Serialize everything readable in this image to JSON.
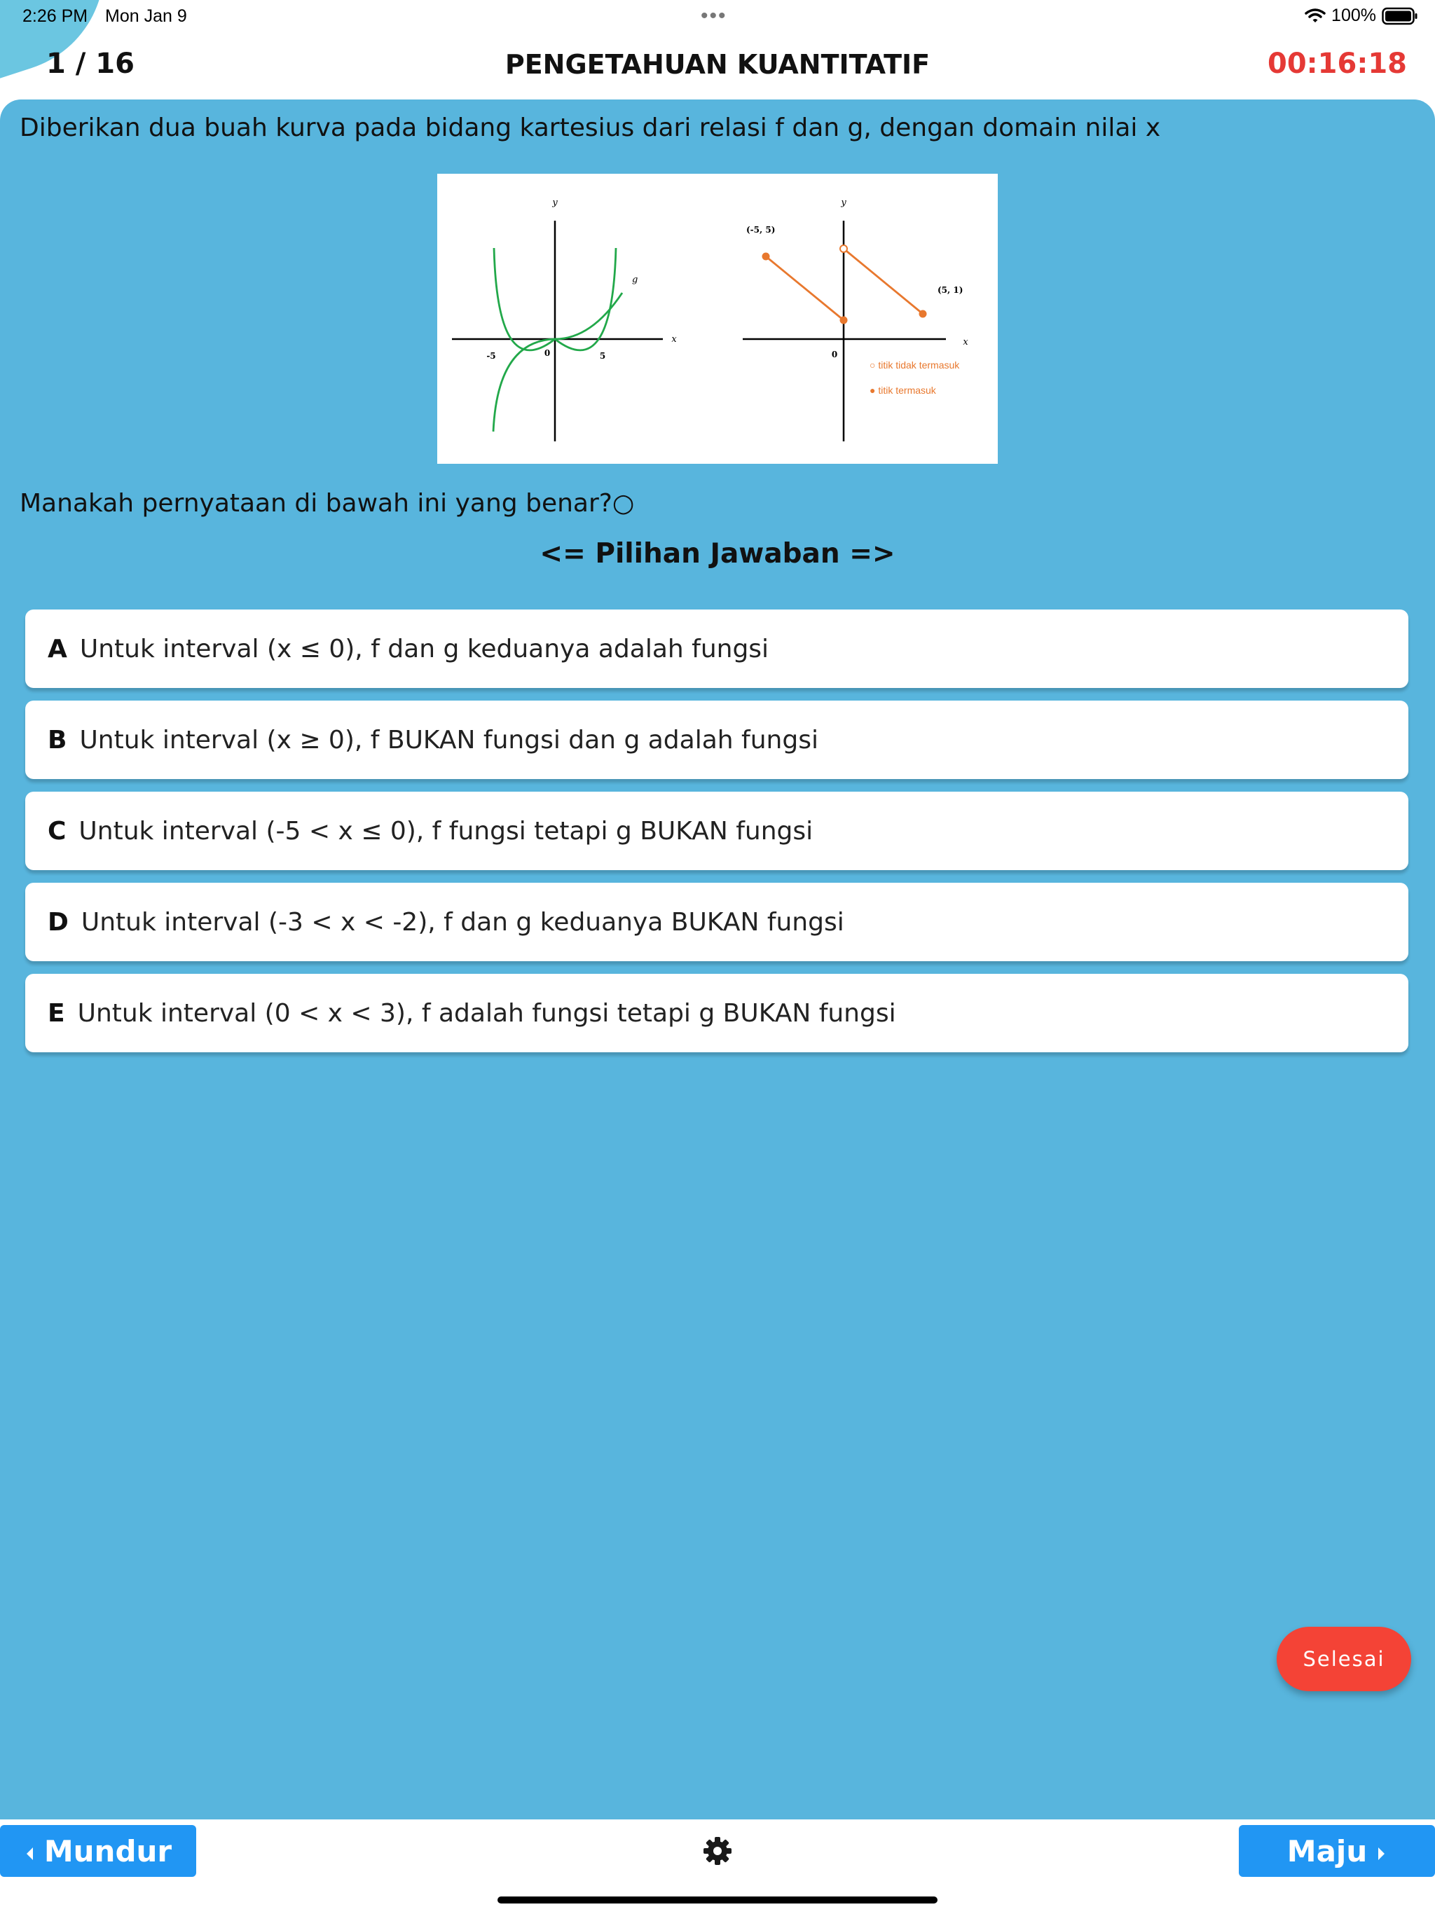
{
  "status": {
    "time": "2:26 PM",
    "date": "Mon Jan 9",
    "dots": "•••",
    "battery": "100%"
  },
  "header": {
    "counter": "1 / 16",
    "title": "PENGETAHUAN KUANTITATIF",
    "timer": "00:16:18"
  },
  "question": {
    "text": "Diberikan dua buah kurva pada bidang kartesius dari relasi f dan g, dengan domain nilai x",
    "prompt": "Manakah pernyataan di bawah ini yang benar?○"
  },
  "figure": {
    "left": {
      "y_label": "y",
      "x_label": "x",
      "curve_label": "g",
      "tick_neg5": "-5",
      "tick_0": "0",
      "tick_5": "5"
    },
    "right": {
      "y_label": "y",
      "x_label": "x",
      "origin": "0",
      "point_a": "(-5, 5)",
      "point_b": "(5, 1)",
      "legend_open": "○ titik tidak termasuk",
      "legend_closed": "● titik termasuk"
    },
    "colors": {
      "green": "#22a84a",
      "orange": "#e8782e"
    }
  },
  "choices_header": "<= Pilihan Jawaban =>",
  "choices": [
    {
      "letter": "A",
      "text": "Untuk interval (x ≤ 0), f dan g keduanya adalah fungsi"
    },
    {
      "letter": "B",
      "text": "Untuk interval (x ≥ 0), f BUKAN fungsi dan g adalah fungsi"
    },
    {
      "letter": "C",
      "text": "Untuk interval (-5 < x ≤ 0), f fungsi tetapi g BUKAN fungsi"
    },
    {
      "letter": "D",
      "text": "Untuk interval (-3 < x < -2), f dan g keduanya BUKAN fungsi"
    },
    {
      "letter": "E",
      "text": "Untuk interval (0 < x < 3), f adalah fungsi tetapi g BUKAN fungsi"
    }
  ],
  "finish_label": "Selesai",
  "nav": {
    "prev_label": "Mundur",
    "next_label": "Maju",
    "settings_icon": "gear-icon"
  }
}
